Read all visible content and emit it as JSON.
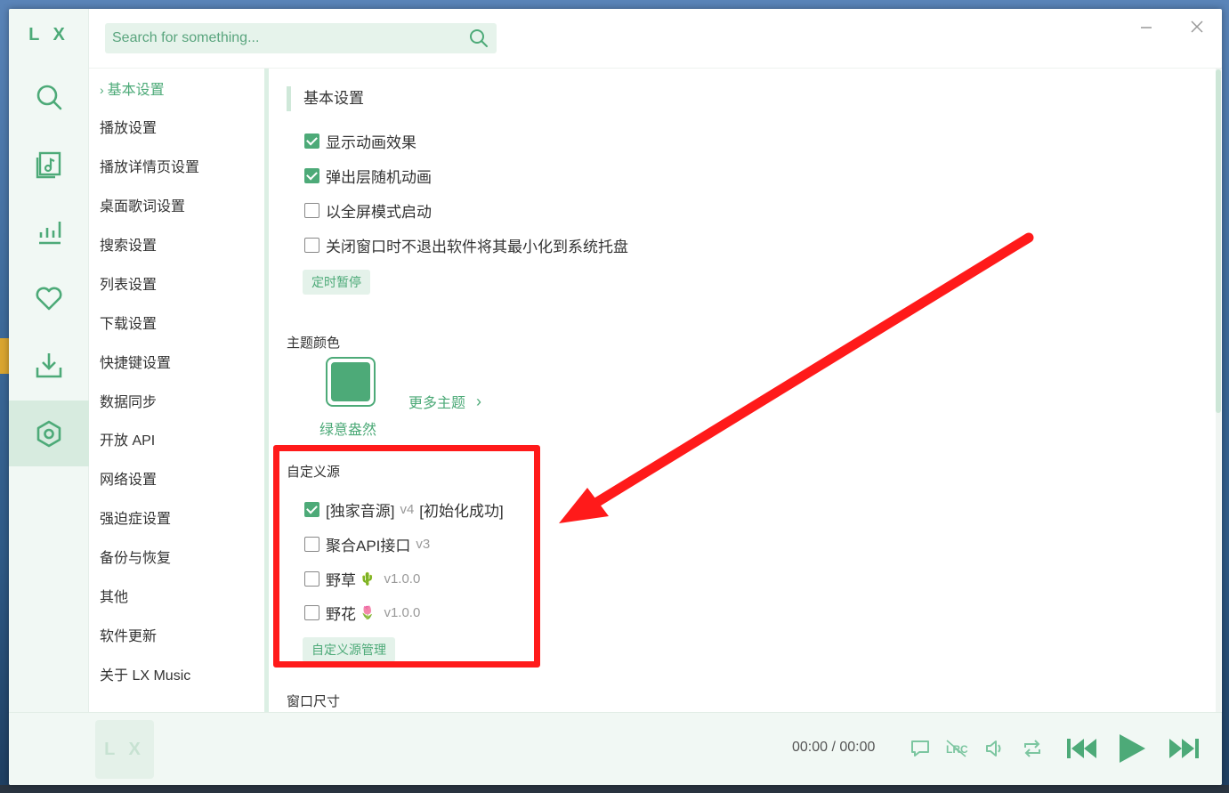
{
  "app": {
    "logo": "L X"
  },
  "search": {
    "placeholder": "Search for something..."
  },
  "sidebar_icons": [
    "search-icon",
    "music-list-icon",
    "chart-icon",
    "heart-icon",
    "download-icon",
    "settings-icon"
  ],
  "categories": [
    "基本设置",
    "播放设置",
    "播放详情页设置",
    "桌面歌词设置",
    "搜索设置",
    "列表设置",
    "下载设置",
    "快捷键设置",
    "数据同步",
    "开放 API",
    "网络设置",
    "强迫症设置",
    "备份与恢复",
    "其他",
    "软件更新",
    "关于 LX Music"
  ],
  "basic": {
    "title": "基本设置",
    "options": [
      {
        "label": "显示动画效果",
        "checked": true
      },
      {
        "label": "弹出层随机动画",
        "checked": true
      },
      {
        "label": "以全屏模式启动",
        "checked": false
      },
      {
        "label": "关闭窗口时不退出软件将其最小化到系统托盘",
        "checked": false
      }
    ],
    "timer_button": "定时暂停"
  },
  "theme": {
    "heading": "主题颜色",
    "current_name": "绿意盎然",
    "current_color": "#4daa78",
    "more_label": "更多主题"
  },
  "custom_source": {
    "heading": "自定义源",
    "items": [
      {
        "label": "[独家音源]",
        "version": "v4",
        "status": "[初始化成功]",
        "checked": true
      },
      {
        "label": "聚合API接口",
        "version": "v3",
        "checked": false
      },
      {
        "label": "野草",
        "emoji": "🌵",
        "version": "v1.0.0",
        "checked": false
      },
      {
        "label": "野花",
        "emoji": "🌷",
        "version": "v1.0.0",
        "checked": false
      }
    ],
    "manage_button": "自定义源管理"
  },
  "window_size": {
    "heading": "窗口尺寸"
  },
  "player": {
    "cover_logo": "L X",
    "time": "00:00 / 00:00"
  },
  "colors": {
    "accent": "#4daa78",
    "annotation": "#ff1a1a"
  }
}
